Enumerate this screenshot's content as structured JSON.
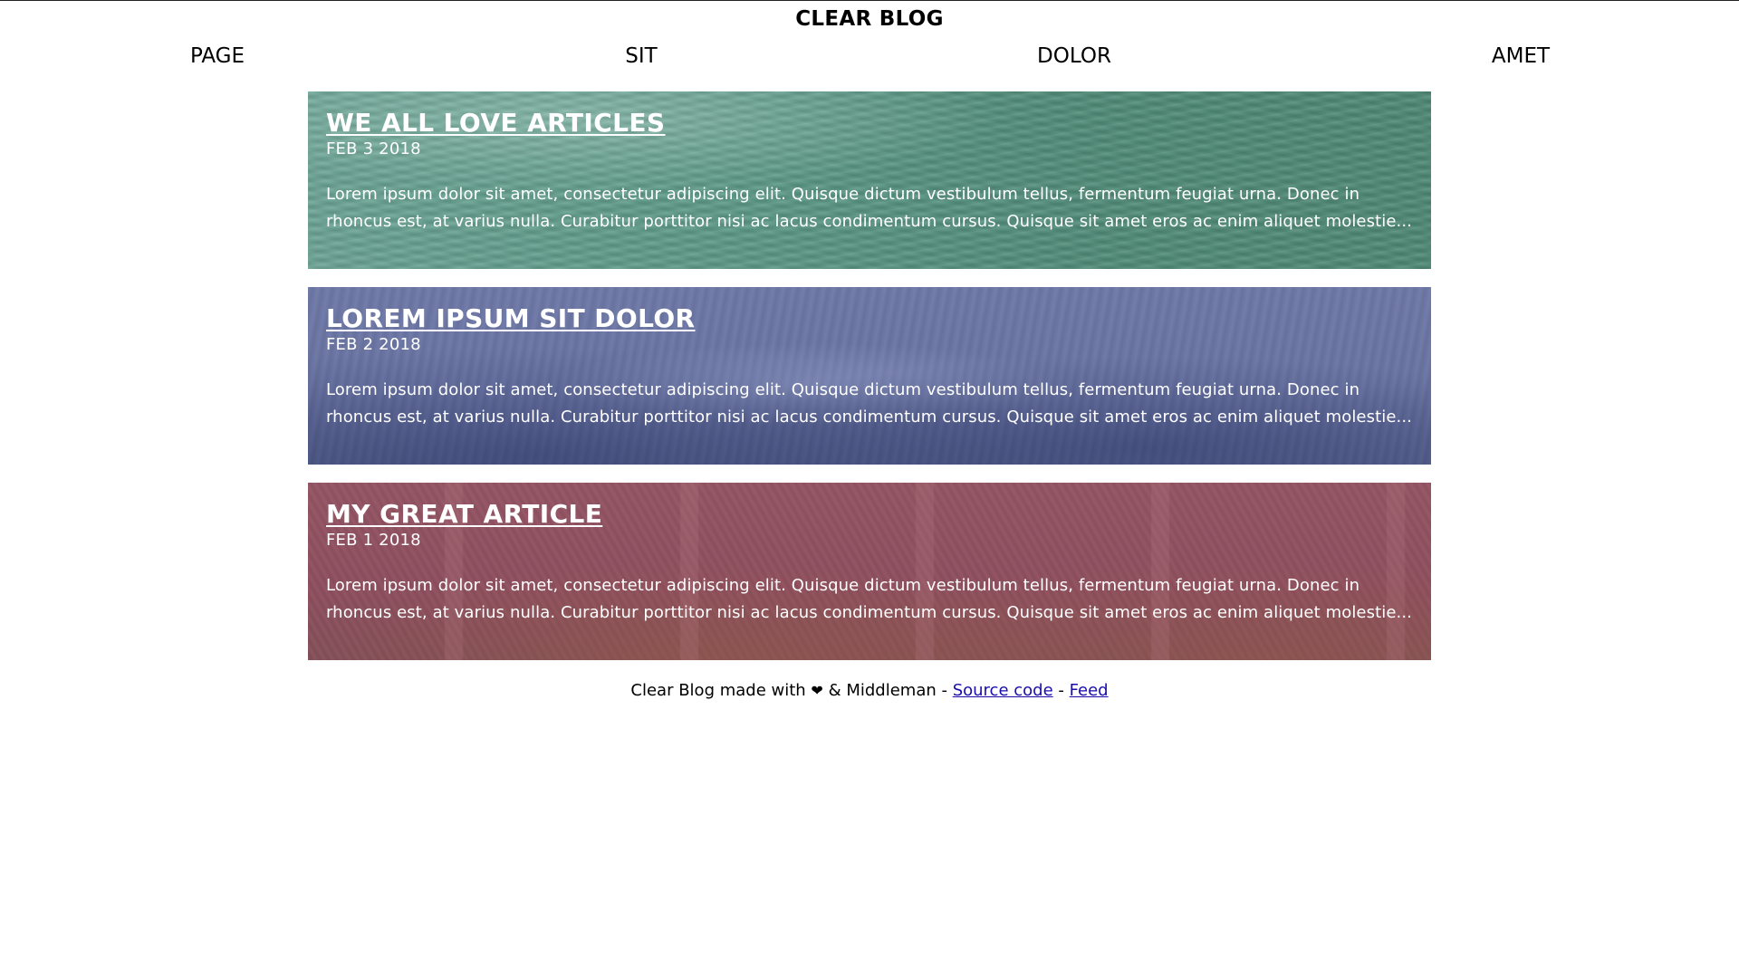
{
  "site": {
    "title": "CLEAR BLOG"
  },
  "nav": {
    "items": [
      {
        "label": "PAGE"
      },
      {
        "label": "SIT"
      },
      {
        "label": "DOLOR"
      },
      {
        "label": "AMET"
      }
    ]
  },
  "posts": [
    {
      "title": "WE ALL LOVE ARTICLES",
      "date": "FEB 3 2018",
      "excerpt": "Lorem ipsum dolor sit amet, consectetur adipiscing elit. Quisque dictum vestibulum tellus, fermentum feugiat urna. Donec in rhoncus est, at varius nulla. Curabitur porttitor nisi ac lacus condimentum cursus. Quisque sit amet eros ac enim aliquet molestie...",
      "tint_color": "#5b9585"
    },
    {
      "title": "LOREM IPSUM SIT DOLOR",
      "date": "FEB 2 2018",
      "excerpt": "Lorem ipsum dolor sit amet, consectetur adipiscing elit. Quisque dictum vestibulum tellus, fermentum feugiat urna. Donec in rhoncus est, at varius nulla. Curabitur porttitor nisi ac lacus condimentum cursus. Quisque sit amet eros ac enim aliquet molestie...",
      "tint_color": "#6a74a3"
    },
    {
      "title": "MY GREAT ARTICLE",
      "date": "FEB 1 2018",
      "excerpt": "Lorem ipsum dolor sit amet, consectetur adipiscing elit. Quisque dictum vestibulum tellus, fermentum feugiat urna. Donec in rhoncus est, at varius nulla. Curabitur porttitor nisi ac lacus condimentum cursus. Quisque sit amet eros ac enim aliquet molestie...",
      "tint_color": "#8f4f5f"
    }
  ],
  "footer": {
    "text_before": "Clear Blog made with",
    "heart_icon": "heart-icon",
    "heart_glyph": "❤",
    "text_middle": "& Middleman -",
    "source_link": "Source code",
    "separator": "-",
    "feed_link": "Feed",
    "link_color": "#1a0dab"
  }
}
